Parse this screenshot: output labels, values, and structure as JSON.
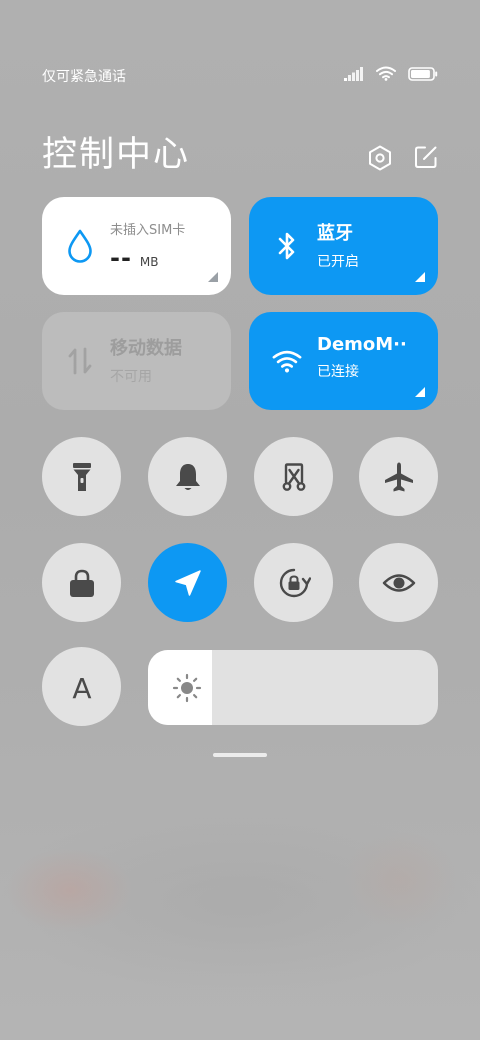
{
  "status_bar": {
    "carrier_text": "仅可紧急通话",
    "icons": [
      "signal-icon",
      "wifi-icon",
      "battery-icon"
    ],
    "battery_level": 0.9
  },
  "header": {
    "title": "控制中心",
    "actions": [
      "settings-icon",
      "edit-icon"
    ]
  },
  "tiles": {
    "data_usage": {
      "label": "未插入SIM卡",
      "value": "--",
      "unit": "MB",
      "icon": "water-drop-icon"
    },
    "bluetooth": {
      "title": "蓝牙",
      "status": "已开启",
      "icon": "bluetooth-icon"
    },
    "mobile_data": {
      "title": "移动数据",
      "status": "不可用",
      "icon": "mobile-data-icon"
    },
    "wifi": {
      "title": "DemoM··",
      "status": "已连接",
      "icon": "wifi-icon"
    }
  },
  "toggles": [
    {
      "name": "flashlight",
      "icon": "flashlight-icon",
      "active": false
    },
    {
      "name": "mute",
      "icon": "bell-icon",
      "active": false
    },
    {
      "name": "screenshot",
      "icon": "screenshot-icon",
      "active": false
    },
    {
      "name": "airplane",
      "icon": "airplane-icon",
      "active": false
    },
    {
      "name": "lock-screen",
      "icon": "lock-icon",
      "active": false
    },
    {
      "name": "location",
      "icon": "location-icon",
      "active": true
    },
    {
      "name": "auto-rotate",
      "icon": "rotation-lock-icon",
      "active": false
    },
    {
      "name": "reading-mode",
      "icon": "eye-icon",
      "active": false
    },
    {
      "name": "auto-brightness",
      "icon": "font-a-icon",
      "active": false
    }
  ],
  "toggle_labels": {
    "auto_brightness": "A"
  },
  "brightness": {
    "level": 0.22,
    "icon": "sun-icon"
  },
  "colors": {
    "accent": "#0d98f3",
    "toggle_bg": "#e2e2e2",
    "icon_dark": "#4a4a4a"
  }
}
